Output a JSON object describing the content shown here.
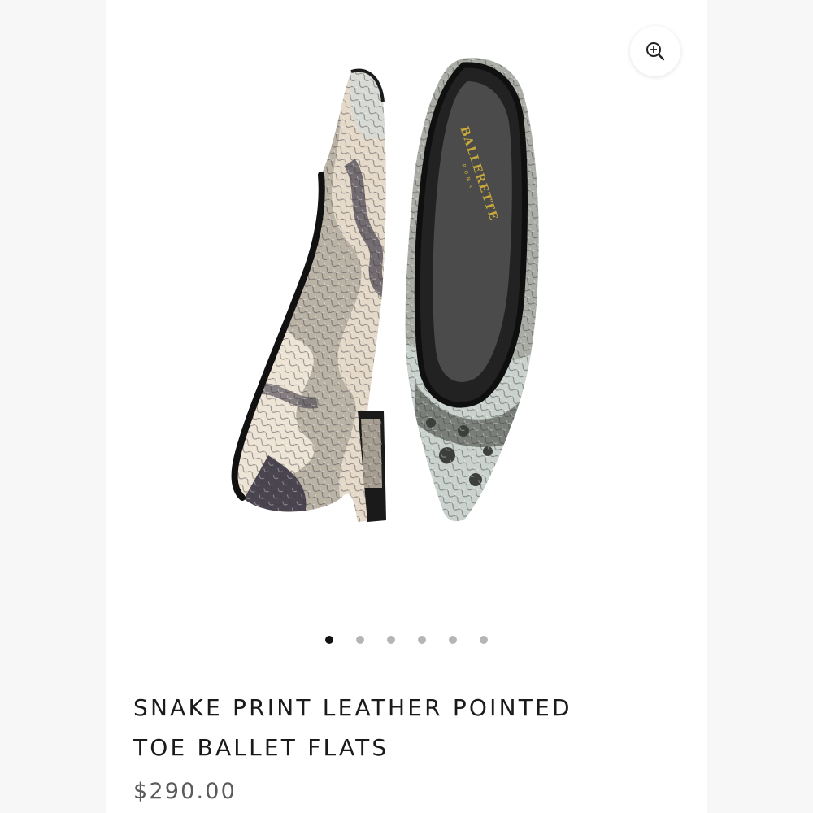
{
  "gallery": {
    "slide_count": 6,
    "active_index": 0,
    "insole_brand": "BALLERETTE",
    "insole_city": "ROMA",
    "zoom_icon": "zoom-in-icon"
  },
  "product": {
    "title_line1": "SNAKE PRINT LEATHER POINTED",
    "title_line2": "TOE BALLET FLATS",
    "price": "$290.00"
  },
  "colors": {
    "page_bg": "#f7f7f7",
    "card_bg": "#ffffff",
    "text": "#1a1a1a",
    "price_text": "#5a5a5a",
    "dot_active": "#111111",
    "dot_inactive": "#b5b5b5",
    "insole_logo": "#c9a93b"
  }
}
